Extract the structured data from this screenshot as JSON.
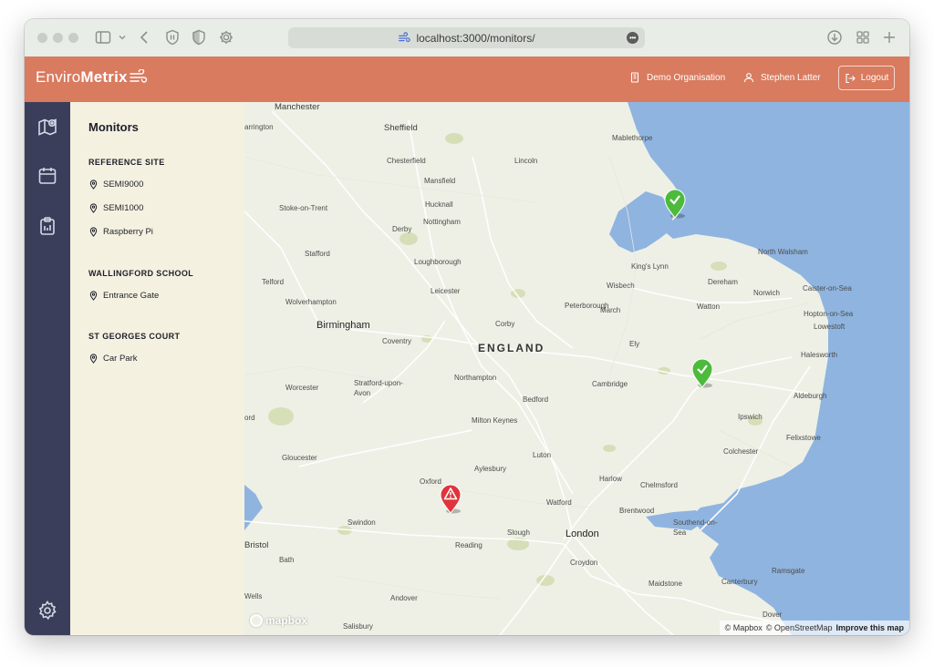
{
  "browser": {
    "url": "localhost:3000/monitors/"
  },
  "header": {
    "logo_part1": "Enviro",
    "logo_part2": "Metrix",
    "organisation": "Demo Organisation",
    "user": "Stephen Latter",
    "logout_label": "Logout",
    "background_color": "#d97b5f"
  },
  "sidebar": {
    "title": "Monitors",
    "groups": [
      {
        "name": "REFERENCE SITE",
        "items": [
          "SEMI9000",
          "SEMI1000",
          "Raspberry Pi"
        ]
      },
      {
        "name": "WALLINGFORD SCHOOL",
        "items": [
          "Entrance Gate"
        ]
      },
      {
        "name": "ST GEORGES COURT",
        "items": [
          "Car Park"
        ]
      }
    ]
  },
  "map": {
    "country": "ENGLAND",
    "large_places": [
      "Birmingham",
      "London"
    ],
    "places": [
      "Manchester",
      "Sheffield",
      "Chesterfield",
      "Lincoln",
      "Mansfield",
      "Hucknall",
      "Stoke-on-Trent",
      "Nottingham",
      "Derby",
      "Stafford",
      "Loughborough",
      "King's Lynn",
      "Telford",
      "Wolverhampton",
      "Leicester",
      "Peterborough",
      "Norwich",
      "Corby",
      "Coventry",
      "Lowestoft",
      "Worcester",
      "Stratford-upon-Avon",
      "Northampton",
      "Cambridge",
      "Bedford",
      "Ipswich",
      "Milton Keynes",
      "Gloucester",
      "Luton",
      "Colchester",
      "Felixstowe",
      "Aylesbury",
      "Oxford",
      "Harlow",
      "Chelmsford",
      "Watford",
      "Brentwood",
      "Swindon",
      "Slough",
      "Southend-on-Sea",
      "Bristol",
      "Reading",
      "Bath",
      "Croydon",
      "Canterbury",
      "Maidstone",
      "Wells",
      "Andover",
      "Salisbury",
      "Dover",
      "Ramsgate",
      "Aldeburgh",
      "Halesworth",
      "Watton",
      "Dereham",
      "March",
      "Ely",
      "Wisbech",
      "North Walsham",
      "Caister-on-Sea",
      "Hopton-on-Sea",
      "Mablethorpe"
    ],
    "partial_places": [
      "arrington",
      "ord"
    ],
    "markers": [
      {
        "status": "ok",
        "color": "#4cba3b"
      },
      {
        "status": "ok",
        "color": "#4cba3b"
      },
      {
        "status": "alert",
        "color": "#e0343b"
      }
    ],
    "logo": "mapbox",
    "attribution": [
      "© Mapbox",
      "© OpenStreetMap",
      "Improve this map"
    ]
  }
}
